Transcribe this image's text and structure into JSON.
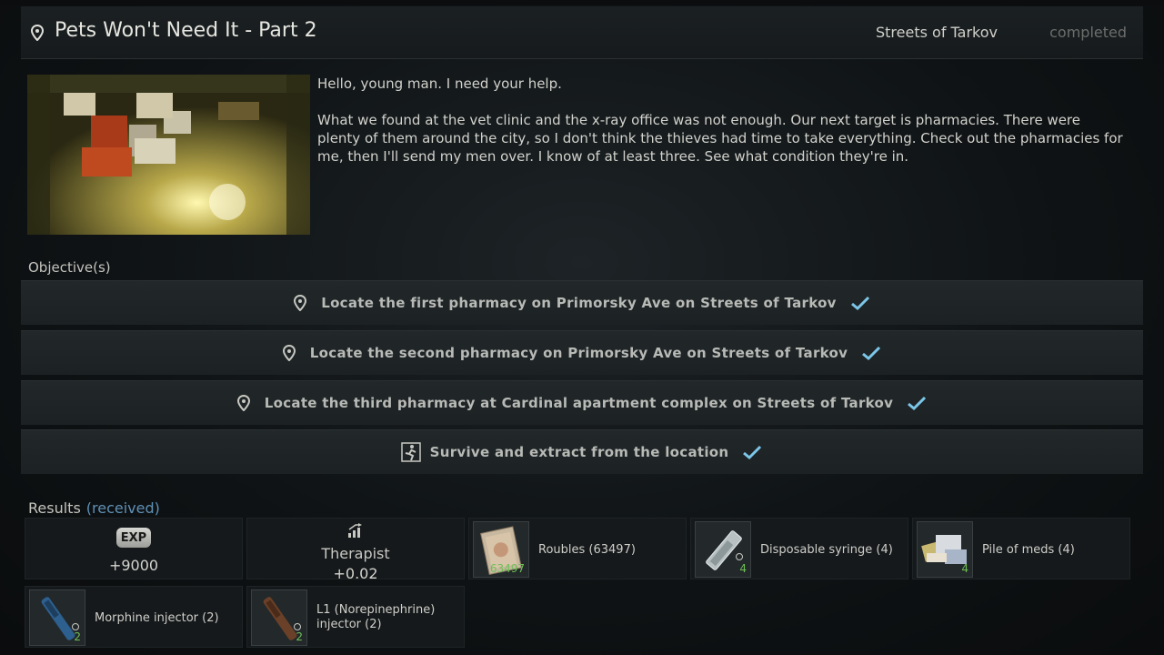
{
  "header": {
    "title": "Pets Won't Need It - Part 2",
    "location": "Streets of Tarkov",
    "status": "completed"
  },
  "description": {
    "greeting": "Hello, young man. I need your help.",
    "body": "What we found at the vet clinic and the x-ray office was not enough. Our next target is pharmacies. There were plenty of them around the city, so I don't think the thieves had time to take everything. Check out the pharmacies for me, then I'll send my men over. I know of at least three. See what condition they're in."
  },
  "objectives": {
    "label": "Objective(s)",
    "items": [
      {
        "text": "Locate the first pharmacy on Primorsky Ave on Streets of Tarkov",
        "icon": "location-pin-icon",
        "completed": true
      },
      {
        "text": "Locate the second pharmacy on Primorsky Ave on Streets of Tarkov",
        "icon": "location-pin-icon",
        "completed": true
      },
      {
        "text": "Locate the third pharmacy at Cardinal apartment complex on Streets of Tarkov",
        "icon": "location-pin-icon",
        "completed": true
      },
      {
        "text": "Survive and extract from the location",
        "icon": "exit-runner-icon",
        "completed": true
      }
    ]
  },
  "results": {
    "label": "Results",
    "received": "(received)",
    "exp": {
      "badge": "EXP",
      "value": "+9000"
    },
    "trader": {
      "name": "Therapist",
      "value": "+0.02"
    },
    "items": [
      {
        "name": "Roubles (63497)",
        "count": "63497",
        "icon": "roubles-icon"
      },
      {
        "name": "Disposable syringe (4)",
        "count": "4",
        "icon": "syringe-icon"
      },
      {
        "name": "Pile of meds (4)",
        "count": "4",
        "icon": "meds-icon"
      },
      {
        "name": "Morphine injector (2)",
        "count": "2",
        "icon": "morphine-injector-icon"
      },
      {
        "name": "L1 (Norepinephrine) injector (2)",
        "count": "2",
        "icon": "l1-injector-icon"
      }
    ]
  },
  "colors": {
    "check": "#7cc6e8",
    "received": "#5f90b5",
    "count": "#6fbf57"
  }
}
